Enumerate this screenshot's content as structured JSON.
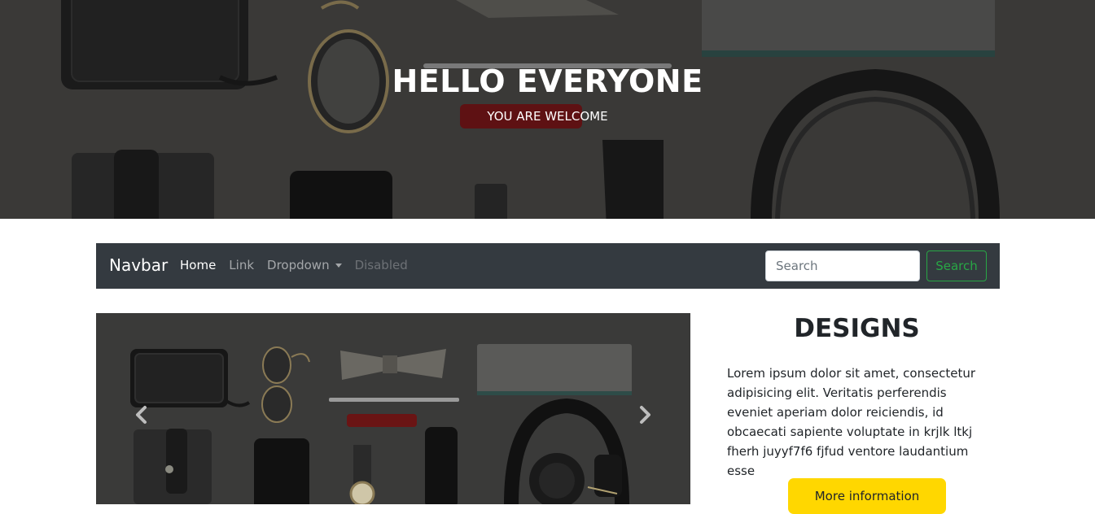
{
  "hero": {
    "title": "HELLO EVERYONE",
    "subtitle": "YOU ARE WELCOME"
  },
  "navbar": {
    "brand": "Navbar",
    "links": [
      {
        "label": "Home",
        "state": "active"
      },
      {
        "label": "Link",
        "state": "normal"
      },
      {
        "label": "Dropdown",
        "state": "dropdown"
      },
      {
        "label": "Disabled",
        "state": "disabled"
      }
    ],
    "search": {
      "placeholder": "Search",
      "value": "",
      "button_label": "Search"
    }
  },
  "carousel": {
    "prev_icon": "chevron-left-icon",
    "next_icon": "chevron-right-icon"
  },
  "sidebar": {
    "title": "DESIGNS",
    "text": "Lorem ipsum dolor sit amet, consectetur adipisicing elit. Veritatis perferendis eveniet aperiam dolor reiciendis, id obcaecati sapiente voluptate in krjlk ltkj fherh juyyf7f6 fjfud ventore laudantium esse",
    "button_label": "More information"
  },
  "colors": {
    "navbar_bg": "#343a40",
    "search_button": "#28a745",
    "info_button": "#ffd700",
    "hero_text": "#ffffff"
  }
}
